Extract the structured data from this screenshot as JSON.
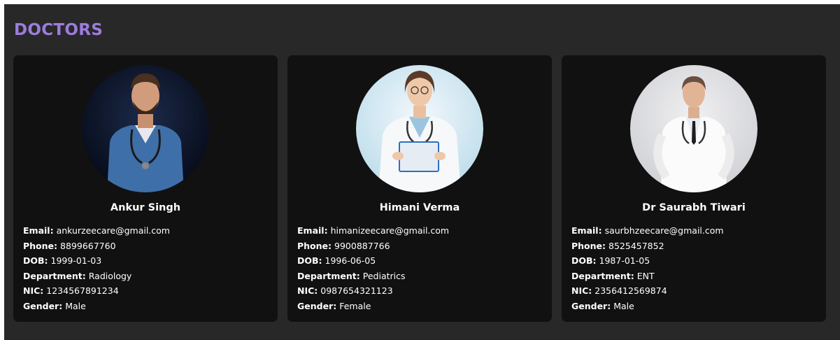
{
  "page": {
    "title": "DOCTORS"
  },
  "doctors": [
    {
      "name": "Ankur Singh",
      "email": "ankurzeecare@gmail.com",
      "phone": "8899667760",
      "dob": "1999-01-03",
      "department": "Radiology",
      "nic": "1234567891234",
      "gender": "Male"
    },
    {
      "name": "Himani Verma",
      "email": "himanizeecare@gmail.com",
      "phone": "9900887766",
      "dob": "1996-06-05",
      "department": "Pediatrics",
      "nic": "0987654321123",
      "gender": "Female"
    },
    {
      "name": "Dr Saurabh Tiwari",
      "email": "saurbhzeecare@gmail.com",
      "phone": "8525457852",
      "dob": "1987-01-05",
      "department": "ENT",
      "nic": "2356412569874",
      "gender": "Male"
    }
  ],
  "labels": {
    "email": "Email:",
    "phone": "Phone:",
    "dob": "DOB:",
    "department": "Department:",
    "nic": "NIC:",
    "gender": "Gender:"
  },
  "colors": {
    "background": "#282828",
    "card": "#111111",
    "title": "#9c7cdc",
    "text": "#ffffff"
  }
}
